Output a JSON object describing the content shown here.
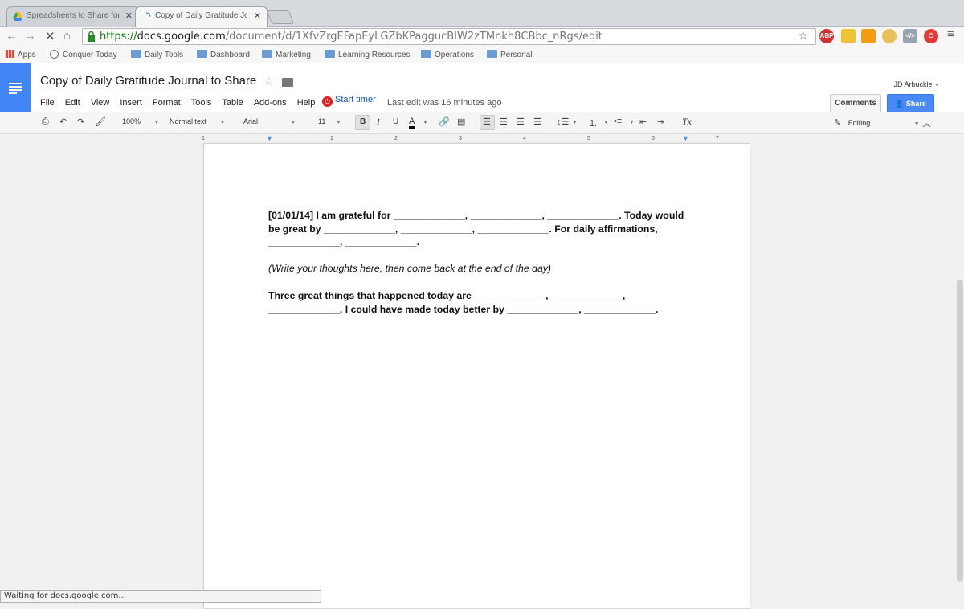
{
  "browser": {
    "tabs": [
      {
        "title": "Spreadsheets to Share for",
        "active": false
      },
      {
        "title": "Copy of Daily Gratitude Jo",
        "active": true
      }
    ],
    "url": {
      "scheme": "https://",
      "host": "docs.google.com",
      "path": "/document/d/1XfvZrgEFapEyLGZbKPaggucBIW2zTMnkh8CBbc_nRgs/edit"
    },
    "extensions": [
      "ABP"
    ],
    "bookmarks": [
      "Apps",
      "Conquer Today",
      "Daily Tools",
      "Dashboard",
      "Marketing",
      "Learning Resources",
      "Operations",
      "Personal"
    ],
    "status": "Waiting for docs.google.com..."
  },
  "docs": {
    "title": "Copy of Daily Gratitude Journal to Share",
    "menu": [
      "File",
      "Edit",
      "View",
      "Insert",
      "Format",
      "Tools",
      "Table",
      "Add-ons",
      "Help"
    ],
    "timer_label": "Start timer",
    "last_edit": "Last edit was 16 minutes ago",
    "user": "JD Arbuckle",
    "comments_label": "Comments",
    "share_label": "Share",
    "toolbar": {
      "zoom": "100%",
      "style": "Normal text",
      "font": "Arial",
      "size": "11",
      "bold": "B",
      "italic": "I",
      "underline": "U",
      "text_color": "A",
      "clear_format": "Tx",
      "mode": "Editing"
    },
    "ruler_numbers": [
      "1",
      "1",
      "2",
      "3",
      "4",
      "5",
      "6",
      "7"
    ]
  },
  "document": {
    "p1": "[01/01/14] I am grateful for _____________, _____________,  _____________. Today would be great by _____________, _____________,  _____________. For daily affirmations, _____________, _____________.",
    "p2": "(Write your thoughts here, then come back at the end of the day)",
    "p3": "Three great things that happened today are _____________, _____________, _____________. I could have made today better by _____________, _____________."
  }
}
